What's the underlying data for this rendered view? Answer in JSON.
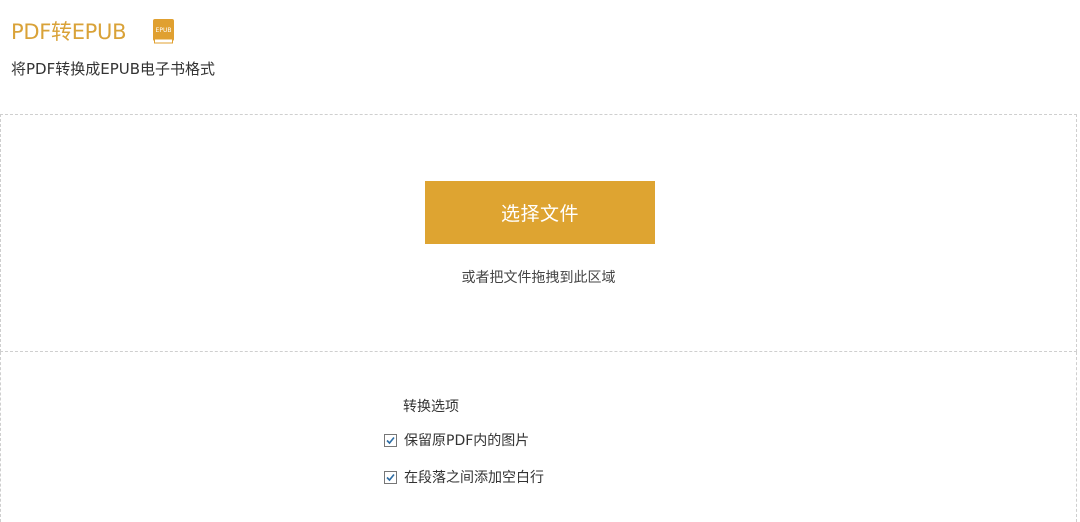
{
  "header": {
    "title": "PDF转EPUB",
    "icon": "epub-book-icon",
    "icon_text": "EPUB",
    "subtitle": "将PDF转换成EPUB电子书格式"
  },
  "upload": {
    "button_label": "选择文件",
    "drop_hint": "或者把文件拖拽到此区域"
  },
  "options": {
    "title": "转换选项",
    "items": [
      {
        "label": "保留原PDF内的图片",
        "checked": true
      },
      {
        "label": "在段落之间添加空白行",
        "checked": true
      }
    ]
  },
  "colors": {
    "accent": "#dea431",
    "title": "#d9a238",
    "check": "#2e6da4"
  }
}
